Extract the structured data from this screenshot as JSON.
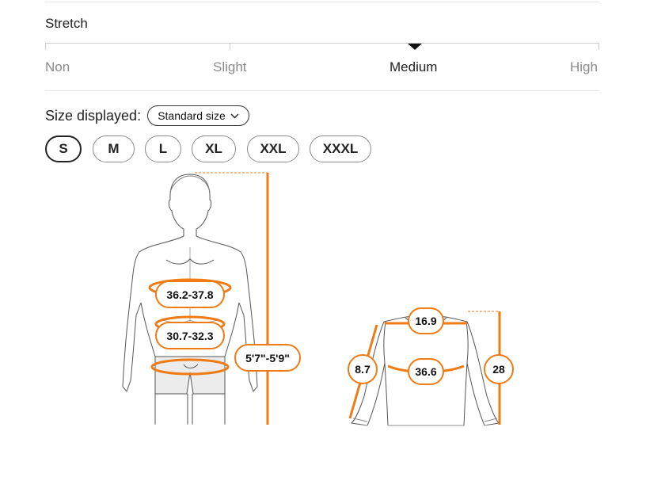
{
  "stretch": {
    "title": "Stretch",
    "levels": [
      "Non",
      "Slight",
      "Medium",
      "High"
    ],
    "selected": "Medium"
  },
  "size_display": {
    "label": "Size displayed:",
    "selected": "Standard size",
    "chevron_icon": "chevron-down-icon"
  },
  "sizes": [
    "S",
    "M",
    "L",
    "XL",
    "XXL",
    "XXXL"
  ],
  "selected_size": "S",
  "body_measurements": {
    "chest": "36.2-37.8",
    "waist": "30.7-32.3",
    "height": "5'7\"-5'9\""
  },
  "garment_measurements": {
    "shoulder": "16.9",
    "sleeve": "8.7",
    "chest": "36.6",
    "length": "28"
  },
  "colors": {
    "accent": "#f07a14",
    "line": "#555555",
    "muted": "#8a8a8a"
  }
}
